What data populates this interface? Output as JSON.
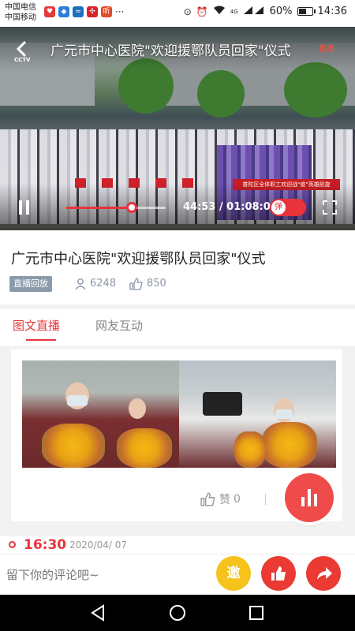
{
  "status_bar": {
    "carrier_1": "中国电信",
    "carrier_2": "中国移动",
    "network_label": "4G",
    "battery": "60%",
    "battery_level": 0.6,
    "time": "14:36"
  },
  "video": {
    "title": "广元市中心医院\"欢迎援鄂队员回家\"仪式",
    "channel_logo": "CCTV",
    "live_mark": "直播",
    "banner_text": "普陀区全体职工欢迎战\"疫\"英雄凯旋",
    "current_time": "44:53",
    "duration": "01:08:00",
    "time_display": "44:53 / 01:08:00",
    "progress": 0.66,
    "danmu_label": "弹"
  },
  "info": {
    "title": "广元市中心医院\"欢迎援鄂队员回家\"仪式",
    "badge": "直播回放",
    "viewers": "6248",
    "likes": "850"
  },
  "tabs": [
    {
      "label": "图文直播",
      "active": true
    },
    {
      "label": "网友互动",
      "active": false
    }
  ],
  "post": {
    "like_label": "赞",
    "like_count": "0"
  },
  "timeline": {
    "time": "16:30",
    "date": "2020/04/ 07"
  },
  "bottom_bar": {
    "comment_placeholder": "留下你的评论吧~",
    "invite_label": "邀"
  },
  "colors": {
    "accent": "#e8333b",
    "invite": "#f6c21c",
    "badge": "#8a9aaa",
    "meta": "#8a96a8"
  }
}
